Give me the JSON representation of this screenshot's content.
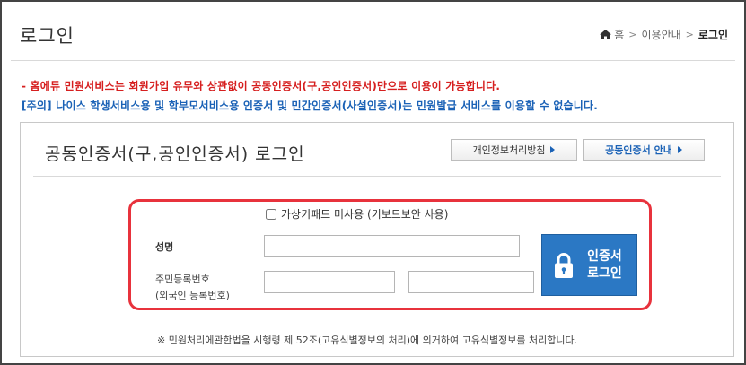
{
  "header": {
    "title": "로그인",
    "breadcrumb": {
      "home_icon": "home-icon",
      "items": [
        "홈",
        "이용안내",
        "로그인"
      ],
      "separator": ">"
    }
  },
  "notices": {
    "red": "- 홈에듀 민원서비스는 회원가입 유무와 상관없이 공동인증서(구,공인인증서)만으로 이용이 가능합니다.",
    "blue": "[주의] 나이스 학생서비스용 및 학부모서비스용 인증서 및 민간인증서(사설인증서)는 민원발급 서비스를 이용할 수 없습니다."
  },
  "login": {
    "title": "공동인증서(구,공인인증서) 로그인",
    "privacy_button": "개인정보처리방침",
    "cert_guide_button": "공동인증서 안내",
    "keypad_checkbox": {
      "label": "가상키패드 미사용 (키보드보안 사용)",
      "checked": false
    },
    "name_label": "성명",
    "name_value": "",
    "rrn_label_line1": "주민등록번호",
    "rrn_label_line2": "(외국인 등록번호)",
    "rrn_front_value": "",
    "rrn_back_value": "",
    "rrn_dash": "–",
    "cert_button_line1": "인증서",
    "cert_button_line2": "로그인",
    "cert_button_icon": "lock-icon",
    "footnote": "※ 민원처리에관한법을 시행령 제 52조(고유식별정보의 처리)에 의거하여 고유식별정보를 처리합니다."
  },
  "colors": {
    "accent_blue": "#2b78c4",
    "notice_red": "#d61f1f",
    "notice_blue": "#1b62b6",
    "highlight_frame": "#e8323c"
  }
}
